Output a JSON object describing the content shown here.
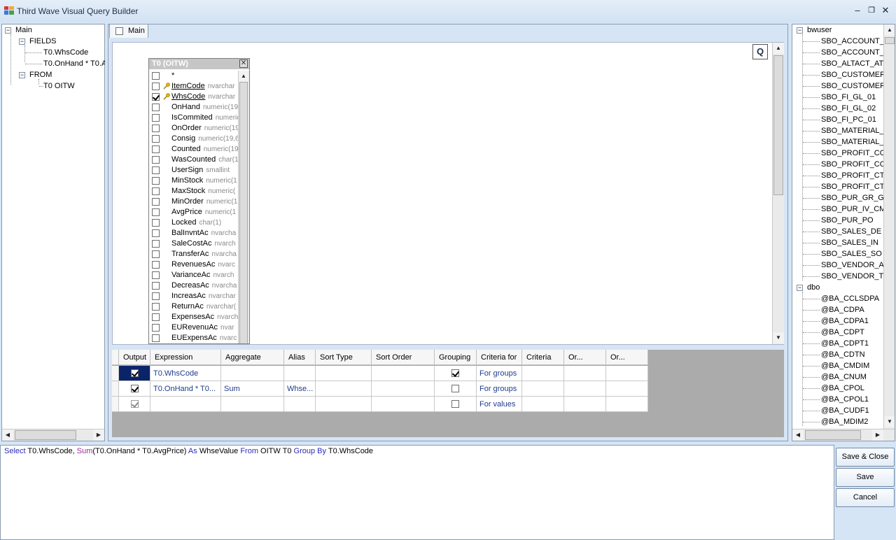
{
  "window": {
    "title": "Third Wave Visual Query Builder",
    "minimize": "–",
    "maximize": "❐",
    "close": "✕"
  },
  "left_tree": {
    "root": "Main",
    "fields_label": "FIELDS",
    "fields": [
      "T0.WhsCode",
      "T0.OnHand * T0.A"
    ],
    "from_label": "FROM",
    "from": [
      "T0 OITW"
    ]
  },
  "tab": {
    "label": "Main"
  },
  "q_button": "Q",
  "table_window": {
    "title": "T0 (OITW)",
    "close": "✕",
    "columns": [
      {
        "name": "*",
        "type": "",
        "checked": false,
        "key": false
      },
      {
        "name": "ItemCode",
        "type": "nvarchar",
        "checked": false,
        "key": true
      },
      {
        "name": "WhsCode",
        "type": "nvarchar",
        "checked": true,
        "key": true
      },
      {
        "name": "OnHand",
        "type": "numeric(19",
        "checked": false,
        "key": false
      },
      {
        "name": "IsCommited",
        "type": "numeric",
        "checked": false,
        "key": false
      },
      {
        "name": "OnOrder",
        "type": "numeric(19",
        "checked": false,
        "key": false
      },
      {
        "name": "Consig",
        "type": "numeric(19,6",
        "checked": false,
        "key": false
      },
      {
        "name": "Counted",
        "type": "numeric(19",
        "checked": false,
        "key": false
      },
      {
        "name": "WasCounted",
        "type": "char(1",
        "checked": false,
        "key": false
      },
      {
        "name": "UserSign",
        "type": "smallint",
        "checked": false,
        "key": false
      },
      {
        "name": "MinStock",
        "type": "numeric(1",
        "checked": false,
        "key": false
      },
      {
        "name": "MaxStock",
        "type": "numeric(",
        "checked": false,
        "key": false
      },
      {
        "name": "MinOrder",
        "type": "numeric(1",
        "checked": false,
        "key": false
      },
      {
        "name": "AvgPrice",
        "type": "numeric(1",
        "checked": false,
        "key": false
      },
      {
        "name": "Locked",
        "type": "char(1)",
        "checked": false,
        "key": false
      },
      {
        "name": "BalInvntAc",
        "type": "nvarcha",
        "checked": false,
        "key": false
      },
      {
        "name": "SaleCostAc",
        "type": "nvarch",
        "checked": false,
        "key": false
      },
      {
        "name": "TransferAc",
        "type": "nvarcha",
        "checked": false,
        "key": false
      },
      {
        "name": "RevenuesAc",
        "type": "nvarc",
        "checked": false,
        "key": false
      },
      {
        "name": "VarianceAc",
        "type": "nvarch",
        "checked": false,
        "key": false
      },
      {
        "name": "DecreasAc",
        "type": "nvarcha",
        "checked": false,
        "key": false
      },
      {
        "name": "IncreasAc",
        "type": "nvarchar",
        "checked": false,
        "key": false
      },
      {
        "name": "ReturnAc",
        "type": "nvarchar(",
        "checked": false,
        "key": false
      },
      {
        "name": "ExpensesAc",
        "type": "nvarch",
        "checked": false,
        "key": false
      },
      {
        "name": "EURevenuAc",
        "type": "nvar",
        "checked": false,
        "key": false
      },
      {
        "name": "EUExpensAc",
        "type": "nvarc",
        "checked": false,
        "key": false
      }
    ]
  },
  "grid": {
    "headers": [
      "Output",
      "Expression",
      "Aggregate",
      "Alias",
      "Sort Type",
      "Sort Order",
      "Grouping",
      "Criteria for",
      "Criteria",
      "Or...",
      "Or..."
    ],
    "rows": [
      {
        "output": true,
        "expression": "T0.WhsCode",
        "aggregate": "",
        "alias": "",
        "grouping": true,
        "criteria_for": "For groups",
        "selected": true,
        "disabled": false
      },
      {
        "output": true,
        "expression": "T0.OnHand * T0...",
        "aggregate": "Sum",
        "alias": "Whse...",
        "grouping": false,
        "criteria_for": "For groups",
        "selected": false,
        "disabled": false
      },
      {
        "output": true,
        "expression": "",
        "aggregate": "",
        "alias": "",
        "grouping": false,
        "criteria_for": "For values",
        "selected": false,
        "disabled": true
      }
    ]
  },
  "right_tree": {
    "schema1": "bwuser",
    "schema1_items": [
      "SBO_ACCOUNT_A",
      "SBO_ACCOUNT_T",
      "SBO_ALTACT_AT",
      "SBO_CUSTOMER",
      "SBO_CUSTOMER_",
      "SBO_FI_GL_01",
      "SBO_FI_GL_02",
      "SBO_FI_PC_01",
      "SBO_MATERIAL_A",
      "SBO_MATERIAL_T",
      "SBO_PROFIT_COI",
      "SBO_PROFIT_COI",
      "SBO_PROFIT_CTF",
      "SBO_PROFIT_CTF",
      "SBO_PUR_GR_GF",
      "SBO_PUR_IV_CM",
      "SBO_PUR_PO",
      "SBO_SALES_DE",
      "SBO_SALES_IN",
      "SBO_SALES_SO",
      "SBO_VENDOR_AT",
      "SBO_VENDOR_TE"
    ],
    "schema2": "dbo",
    "schema2_items": [
      "@BA_CCLSDPA",
      "@BA_CDPA",
      "@BA_CDPA1",
      "@BA_CDPT",
      "@BA_CDPT1",
      "@BA_CDTN",
      "@BA_CMDIM",
      "@BA_CNUM",
      "@BA_CPOL",
      "@BA_CPOL1",
      "@BA_CUDF1",
      "@BA_MDIM2"
    ]
  },
  "sql": {
    "select_kw": "Select",
    "part1": " T0.WhsCode, ",
    "sum_fn": "Sum",
    "part2": "(T0.OnHand * T0.AvgPrice) ",
    "as_kw": "As",
    "part3": " WhseValue ",
    "from_kw": "From",
    "part4": " OITW T0 ",
    "group_kw": "Group By",
    "part5": " T0.WhsCode"
  },
  "buttons": {
    "save_close": "Save & Close",
    "save": "Save",
    "cancel": "Cancel"
  }
}
